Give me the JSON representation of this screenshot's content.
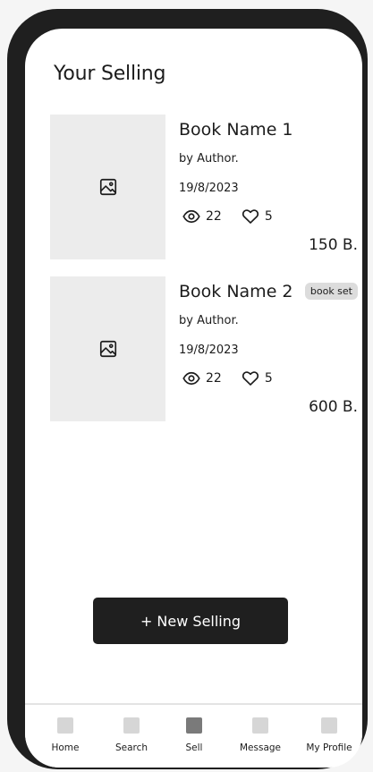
{
  "page": {
    "title": "Your Selling"
  },
  "listings": [
    {
      "name": "Book Name 1",
      "author": "by Author.",
      "date": "19/8/2023",
      "views": "22",
      "likes": "5",
      "price": "150 B.",
      "tag": ""
    },
    {
      "name": "Book Name 2",
      "author": "by Author.",
      "date": "19/8/2023",
      "views": "22",
      "likes": "5",
      "price": "600 B.",
      "tag": "book set"
    }
  ],
  "actions": {
    "new_selling_label": "+ New Selling"
  },
  "tab_bar": {
    "active": "Sell",
    "items": [
      {
        "label": "Home"
      },
      {
        "label": "Search"
      },
      {
        "label": "Sell"
      },
      {
        "label": "Message"
      },
      {
        "label": "My Profile"
      }
    ]
  },
  "icons": {
    "thumbnail": "image-placeholder-icon",
    "views": "eye-icon",
    "likes": "heart-icon",
    "tab": "square-icon"
  },
  "colors": {
    "frame": "#1f1f1f",
    "button": "#1f1f1f",
    "thumbnail_bg": "#ececec",
    "tag_bg": "#dcdcdc",
    "tab_icon": "#d6d6d6",
    "tab_icon_active": "#7a7a7a"
  }
}
